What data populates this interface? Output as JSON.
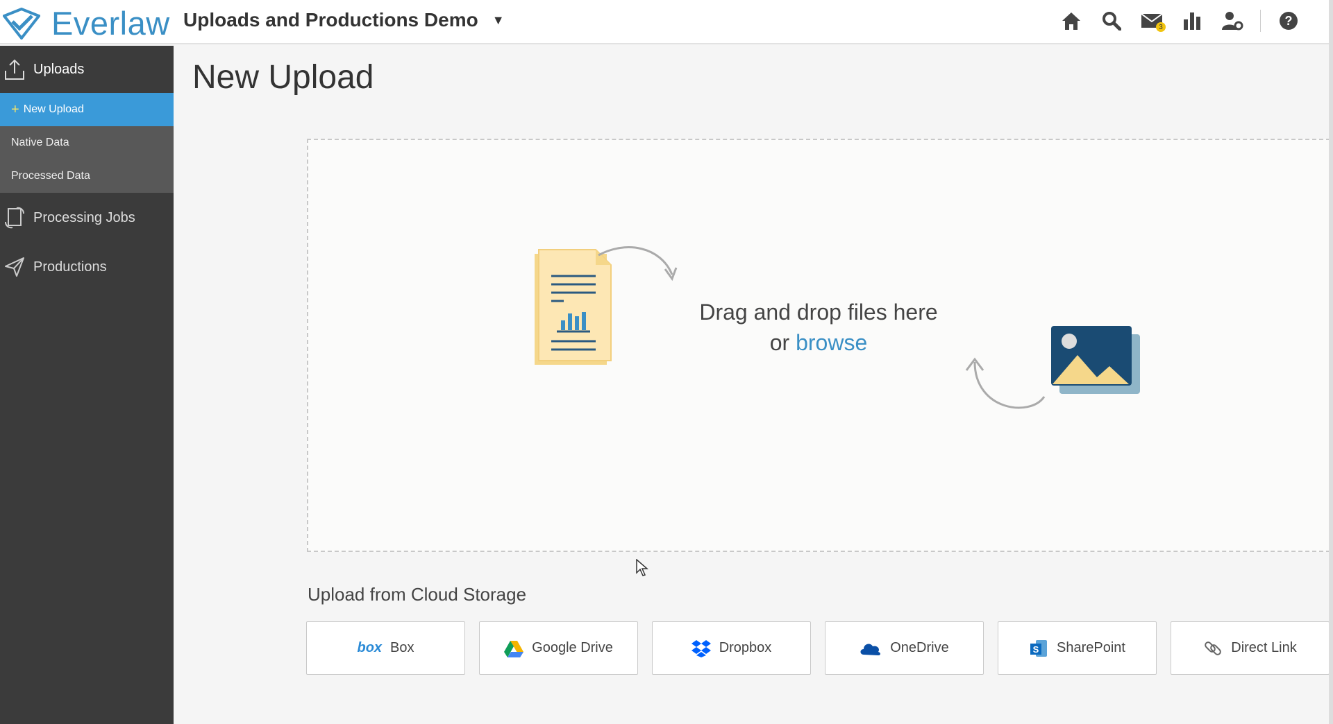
{
  "app": {
    "logo_text": "Everlaw",
    "project_name": "Uploads and Productions Demo",
    "unread_count": "3"
  },
  "sidebar": {
    "uploads_label": "Uploads",
    "sub_items": [
      {
        "label": "New Upload"
      },
      {
        "label": "Native Data"
      },
      {
        "label": "Processed Data"
      }
    ],
    "processing_jobs_label": "Processing Jobs",
    "productions_label": "Productions"
  },
  "main": {
    "title": "New Upload",
    "dropzone": {
      "line1": "Drag and drop files here",
      "or_text": "or",
      "browse_label": "browse"
    },
    "cloud": {
      "title": "Upload from Cloud Storage",
      "services": [
        {
          "label": "Box",
          "icon": "box-icon"
        },
        {
          "label": "Google Drive",
          "icon": "google-drive-icon"
        },
        {
          "label": "Dropbox",
          "icon": "dropbox-icon"
        },
        {
          "label": "OneDrive",
          "icon": "onedrive-icon"
        },
        {
          "label": "SharePoint",
          "icon": "sharepoint-icon"
        },
        {
          "label": "Direct Link",
          "icon": "link-icon"
        }
      ]
    }
  },
  "colors": {
    "accent": "#3a9ad9",
    "brand": "#3a8fc5",
    "sidebar_bg": "#3b3b3b"
  }
}
